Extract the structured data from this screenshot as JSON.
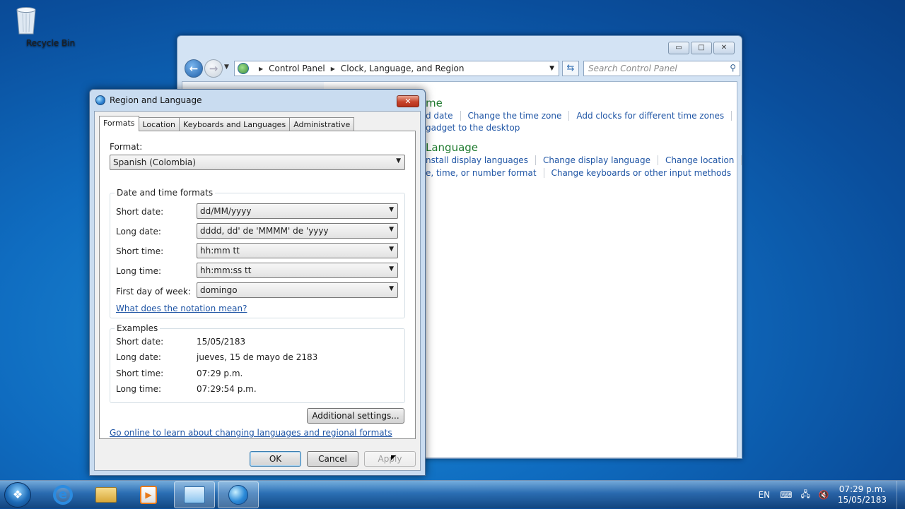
{
  "desktop": {
    "recycle_bin_label": "Recycle Bin"
  },
  "control_panel": {
    "breadcrumb": [
      "Control Panel",
      "Clock, Language, and Region"
    ],
    "search_placeholder": "Search Control Panel",
    "sections": [
      {
        "heading": "me",
        "links_row1": [
          "d date",
          "Change the time zone",
          "Add clocks for different time zones"
        ],
        "links_row2": [
          "gadget to the desktop"
        ]
      },
      {
        "heading": "Language",
        "links_row1": [
          "nstall display languages",
          "Change display language",
          "Change location"
        ],
        "links_row2": [
          "e, time, or number format",
          "Change keyboards or other input methods"
        ]
      }
    ]
  },
  "dialog": {
    "title": "Region and Language",
    "tabs": [
      "Formats",
      "Location",
      "Keyboards and Languages",
      "Administrative"
    ],
    "format_label": "Format:",
    "format_value": "Spanish (Colombia)",
    "date_time_group": "Date and time formats",
    "fields": [
      {
        "label": "Short date:",
        "value": "dd/MM/yyyy"
      },
      {
        "label": "Long date:",
        "value": "dddd, dd' de 'MMMM' de 'yyyy"
      },
      {
        "label": "Short time:",
        "value": "hh:mm tt"
      },
      {
        "label": "Long time:",
        "value": "hh:mm:ss tt"
      },
      {
        "label": "First day of week:",
        "value": "domingo"
      }
    ],
    "notation_link": "What does the notation mean?",
    "examples_group": "Examples",
    "examples": [
      {
        "label": "Short date:",
        "value": "15/05/2183"
      },
      {
        "label": "Long date:",
        "value": "jueves, 15 de mayo de 2183"
      },
      {
        "label": "Short time:",
        "value": "07:29 p.m."
      },
      {
        "label": "Long time:",
        "value": "07:29:54 p.m."
      }
    ],
    "additional_settings": "Additional settings...",
    "online_link": "Go online to learn about changing languages and regional formats",
    "ok": "OK",
    "cancel": "Cancel",
    "apply": "Apply"
  },
  "taskbar": {
    "language": "EN",
    "time": "07:29 p.m.",
    "date": "15/05/2183"
  }
}
